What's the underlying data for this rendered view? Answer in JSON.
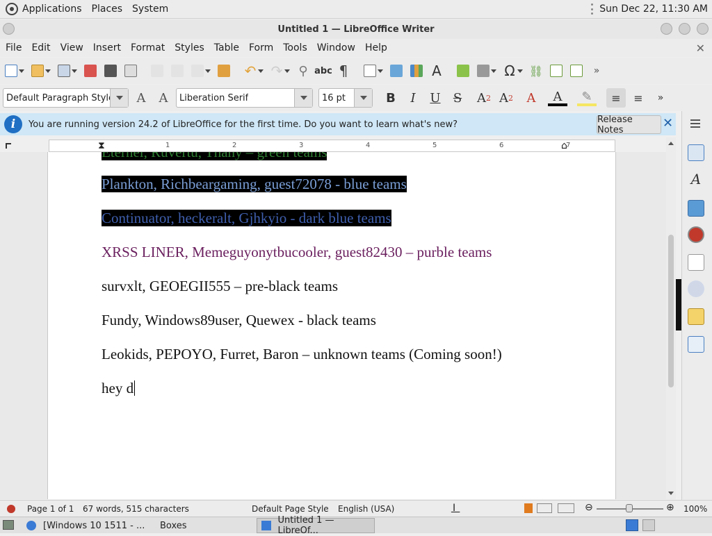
{
  "topbar": {
    "menus": [
      "Applications",
      "Places",
      "System"
    ],
    "clock": "Sun Dec 22, 11:30 AM"
  },
  "window": {
    "title": "Untitled 1 — LibreOffice Writer"
  },
  "menubar": [
    "File",
    "Edit",
    "View",
    "Insert",
    "Format",
    "Styles",
    "Table",
    "Form",
    "Tools",
    "Window",
    "Help"
  ],
  "toolbar1": {
    "icons": [
      "new-document-icon",
      "open-icon",
      "save-icon",
      "export-pdf-icon",
      "print-icon",
      "print-preview-icon",
      "cut-icon",
      "copy-icon",
      "paste-icon",
      "clone-formatting-icon",
      "undo-icon",
      "redo-icon",
      "find-replace-icon",
      "spelling-icon",
      "formatting-marks-icon",
      "insert-table-icon",
      "insert-image-icon",
      "insert-chart-icon",
      "insert-textbox-icon",
      "insert-page-break-icon",
      "insert-field-icon",
      "special-character-icon",
      "hyperlink-icon",
      "footnote-icon",
      "header-footer-icon"
    ]
  },
  "toolbar2": {
    "paragraph_style": "Default Paragraph Style",
    "font_name": "Liberation Serif",
    "font_size": "16 pt"
  },
  "infobar": {
    "message": "You are running version 24.2 of LibreOffice for the first time. Do you want to learn what's new?",
    "release_notes": "Release Notes"
  },
  "ruler": {
    "numbers": [
      "1",
      "2",
      "3",
      "4",
      "5",
      "6",
      "7"
    ]
  },
  "document": {
    "paragraphs": [
      {
        "text": "Eternel, Ruvertu, Thany – green teams",
        "color": "#2e7d32",
        "highlight": true
      },
      {
        "text": "Plankton, Richbeargaming, guest72078 - blue teams",
        "color": "#7a9ed6",
        "highlight": true
      },
      {
        "text": "Continuator, heckeralt, Gjhkyio - dark blue teams",
        "color": "#3f5fae",
        "highlight": true
      },
      {
        "text": "XRSS LINER, Memeguyonytbucooler, guest82430 – purble teams",
        "color": "#6a1f5e",
        "highlight": false
      },
      {
        "text": "survxlt, GEOEGII555 – pre-black teams",
        "color": "#111111",
        "highlight": false
      },
      {
        "text": "Fundy, Windows89user, Quewex - black teams",
        "color": "#111111",
        "highlight": false
      },
      {
        "text": "Leokids, PEPOYO, Furret, Baron – unknown teams (Coming soon!)",
        "color": "#111111",
        "highlight": false
      },
      {
        "text": "hey d",
        "color": "#111111",
        "highlight": false
      }
    ]
  },
  "statusbar": {
    "page": "Page 1 of 1",
    "words": "67 words, 515 characters",
    "page_style": "Default Page Style",
    "language": "English (USA)",
    "zoom": "100%"
  },
  "taskbar": {
    "tasks": [
      "[Windows 10 1511 - ...",
      "Boxes",
      "Untitled 1 — LibreOf..."
    ]
  }
}
